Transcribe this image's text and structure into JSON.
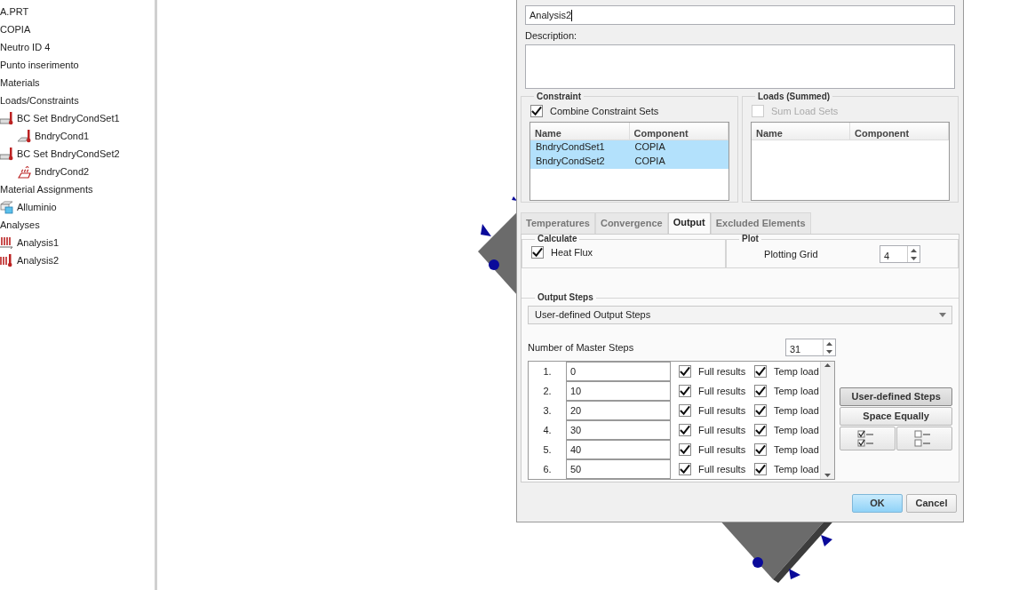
{
  "tree": [
    {
      "label": "A.PRT"
    },
    {
      "label": "COPIA"
    },
    {
      "label": "Neutro ID 4"
    },
    {
      "label": "Punto inserimento"
    },
    {
      "label": "Materials"
    },
    {
      "label": "Loads/Constraints",
      "children": [
        {
          "label": "BC Set BndryCondSet1",
          "kind": "bc_set",
          "children": [
            {
              "label": "BndryCond1",
              "kind": "bc"
            }
          ]
        },
        {
          "label": "BC Set BndryCondSet2",
          "kind": "bc_set",
          "children": [
            {
              "label": "BndryCond2",
              "kind": "heat_load"
            }
          ]
        }
      ]
    },
    {
      "label": "Material Assignments",
      "children": [
        {
          "label": "Alluminio",
          "kind": "material"
        }
      ]
    },
    {
      "label": "Analyses",
      "children": [
        {
          "label": "Analysis1",
          "kind": "analysis"
        },
        {
          "label": "Analysis2",
          "kind": "analysis_temp"
        }
      ]
    }
  ],
  "dialog": {
    "name": {
      "value": "Analysis2"
    },
    "description_label": "Description:",
    "constraint": {
      "title": "Constraint",
      "combine": {
        "label": "Combine Constraint Sets",
        "checked": true,
        "disabled": false
      },
      "columns": [
        "Name",
        "Component"
      ],
      "rows": [
        {
          "name": "BndryCondSet1",
          "component": "COPIA",
          "selected": true
        },
        {
          "name": "BndryCondSet2",
          "component": "COPIA",
          "selected": true
        }
      ]
    },
    "loads": {
      "title": "Loads (Summed)",
      "sum": {
        "label": "Sum Load Sets",
        "checked": false,
        "disabled": true
      },
      "columns": [
        "Name",
        "Component"
      ]
    },
    "tabs": [
      {
        "label": "Temperatures",
        "selected": false
      },
      {
        "label": "Convergence",
        "selected": false
      },
      {
        "label": "Output",
        "selected": true
      },
      {
        "label": "Excluded Elements",
        "selected": false
      }
    ],
    "calculate": {
      "title": "Calculate",
      "heat_flux": {
        "label": "Heat Flux",
        "checked": true,
        "disabled": false
      }
    },
    "plot": {
      "title": "Plot",
      "label": "Plotting Grid",
      "value": "4"
    },
    "output_steps": {
      "title": "Output Steps",
      "mode": "User-defined Output Steps",
      "master_steps_label": "Number of Master Steps",
      "master_steps": "31",
      "steps": [
        {
          "number": "1.",
          "value": "0",
          "full_results": {
            "label": "Full results",
            "checked": true
          },
          "temp_load": {
            "label": "Temp load",
            "checked": true
          }
        },
        {
          "number": "2.",
          "value": "10",
          "full_results": {
            "label": "Full results",
            "checked": true
          },
          "temp_load": {
            "label": "Temp load",
            "checked": true
          }
        },
        {
          "number": "3.",
          "value": "20",
          "full_results": {
            "label": "Full results",
            "checked": true
          },
          "temp_load": {
            "label": "Temp load",
            "checked": true
          }
        },
        {
          "number": "4.",
          "value": "30",
          "full_results": {
            "label": "Full results",
            "checked": true
          },
          "temp_load": {
            "label": "Temp load",
            "checked": true
          }
        },
        {
          "number": "5.",
          "value": "40",
          "full_results": {
            "label": "Full results",
            "checked": true
          },
          "temp_load": {
            "label": "Temp load",
            "checked": true
          }
        },
        {
          "number": "6.",
          "value": "50",
          "full_results": {
            "label": "Full results",
            "checked": true
          },
          "temp_load": {
            "label": "Temp load",
            "checked": true
          }
        }
      ],
      "buttons": [
        {
          "label": "User-defined Steps",
          "selected": true
        },
        {
          "label": "Space Equally",
          "selected": false
        }
      ]
    },
    "footer": {
      "ok": "OK",
      "cancel": "Cancel"
    }
  }
}
